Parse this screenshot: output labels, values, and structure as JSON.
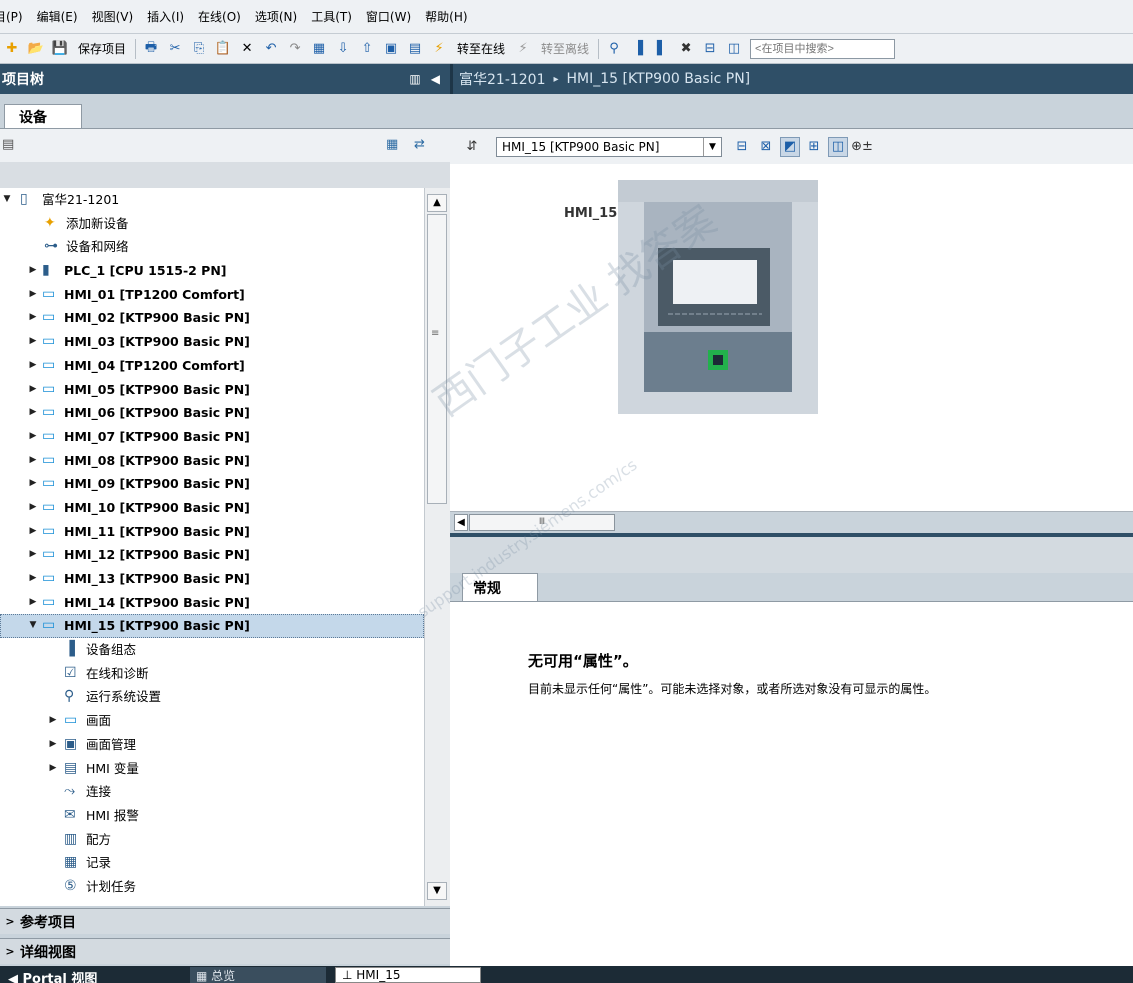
{
  "menu": [
    "目(P)",
    "编辑(E)",
    "视图(V)",
    "插入(I)",
    "在线(O)",
    "选项(N)",
    "工具(T)",
    "窗口(W)",
    "帮助(H)"
  ],
  "toolbar": {
    "save_label": "保存项目",
    "go_online": "转至在线",
    "go_offline": "转至离线",
    "search_placeholder": "<在项目中搜索>"
  },
  "tree": {
    "title": "项目树",
    "tab_devices": "设备",
    "items": [
      {
        "label": "富华21-1201",
        "level": 0,
        "arrow": "down",
        "icon": "project-icon"
      },
      {
        "label": "添加新设备",
        "level": 1,
        "arrow": "",
        "icon": "add-device-icon"
      },
      {
        "label": "设备和网络",
        "level": 1,
        "arrow": "",
        "icon": "network-icon"
      },
      {
        "label": "PLC_1 [CPU 1515-2 PN]",
        "level": 1,
        "arrow": "right",
        "icon": "plc-icon"
      },
      {
        "label": "HMI_01 [TP1200 Comfort]",
        "level": 1,
        "arrow": "right",
        "icon": "hmi-icon"
      },
      {
        "label": "HMI_02 [KTP900 Basic PN]",
        "level": 1,
        "arrow": "right",
        "icon": "hmi-icon"
      },
      {
        "label": "HMI_03 [KTP900 Basic PN]",
        "level": 1,
        "arrow": "right",
        "icon": "hmi-icon"
      },
      {
        "label": "HMI_04 [TP1200 Comfort]",
        "level": 1,
        "arrow": "right",
        "icon": "hmi-icon"
      },
      {
        "label": "HMI_05 [KTP900 Basic PN]",
        "level": 1,
        "arrow": "right",
        "icon": "hmi-icon"
      },
      {
        "label": "HMI_06 [KTP900 Basic PN]",
        "level": 1,
        "arrow": "right",
        "icon": "hmi-icon"
      },
      {
        "label": "HMI_07 [KTP900 Basic PN]",
        "level": 1,
        "arrow": "right",
        "icon": "hmi-icon"
      },
      {
        "label": "HMI_08 [KTP900 Basic PN]",
        "level": 1,
        "arrow": "right",
        "icon": "hmi-icon"
      },
      {
        "label": "HMI_09 [KTP900 Basic PN]",
        "level": 1,
        "arrow": "right",
        "icon": "hmi-icon"
      },
      {
        "label": "HMI_10 [KTP900 Basic PN]",
        "level": 1,
        "arrow": "right",
        "icon": "hmi-icon"
      },
      {
        "label": "HMI_11 [KTP900 Basic PN]",
        "level": 1,
        "arrow": "right",
        "icon": "hmi-icon"
      },
      {
        "label": "HMI_12 [KTP900 Basic PN]",
        "level": 1,
        "arrow": "right",
        "icon": "hmi-icon"
      },
      {
        "label": "HMI_13 [KTP900 Basic PN]",
        "level": 1,
        "arrow": "right",
        "icon": "hmi-icon"
      },
      {
        "label": "HMI_14 [KTP900 Basic PN]",
        "level": 1,
        "arrow": "right",
        "icon": "hmi-icon"
      },
      {
        "label": "HMI_15 [KTP900 Basic PN]",
        "level": 1,
        "arrow": "down",
        "icon": "hmi-icon",
        "selected": true
      },
      {
        "label": "设备组态",
        "level": 2,
        "arrow": "",
        "icon": "device-config-icon"
      },
      {
        "label": "在线和诊断",
        "level": 2,
        "arrow": "",
        "icon": "diagnostics-icon"
      },
      {
        "label": "运行系统设置",
        "level": 2,
        "arrow": "",
        "icon": "runtime-settings-icon"
      },
      {
        "label": "画面",
        "level": 2,
        "arrow": "right",
        "icon": "folder-icon"
      },
      {
        "label": "画面管理",
        "level": 2,
        "arrow": "right",
        "icon": "screen-management-icon"
      },
      {
        "label": "HMI 变量",
        "level": 2,
        "arrow": "right",
        "icon": "hmi-tags-icon"
      },
      {
        "label": "连接",
        "level": 2,
        "arrow": "",
        "icon": "connection-icon"
      },
      {
        "label": "HMI 报警",
        "level": 2,
        "arrow": "",
        "icon": "alarm-icon"
      },
      {
        "label": "配方",
        "level": 2,
        "arrow": "",
        "icon": "recipe-icon"
      },
      {
        "label": "记录",
        "level": 2,
        "arrow": "",
        "icon": "log-icon"
      },
      {
        "label": "计划任务",
        "level": 2,
        "arrow": "",
        "icon": "scheduled-task-icon"
      }
    ],
    "reference_projects": "参考项目",
    "details_view": "详细视图"
  },
  "editor": {
    "breadcrumb_project": "富华21-1201",
    "breadcrumb_device": "HMI_15 [KTP900 Basic PN]",
    "device_select": "HMI_15 [KTP900 Basic PN]",
    "device_label": "HMI_15"
  },
  "properties": {
    "tab_general": "常规",
    "title": "无可用“属性”。",
    "text": "目前未显示任何“属性”。可能未选择对象，或者所选对象没有可显示的属性。"
  },
  "taskbar": {
    "portal_view": "Portal 视图",
    "overview": "总览",
    "hmi_tab": "HMI_15"
  },
  "watermark": {
    "main": "西门子工业 找答案",
    "sub": "support.industry.siemens.com/cs"
  },
  "colors": {
    "header_bg": "#2f4f67",
    "selection": "#c4d8ea",
    "device_green_port": "#22b14c"
  }
}
